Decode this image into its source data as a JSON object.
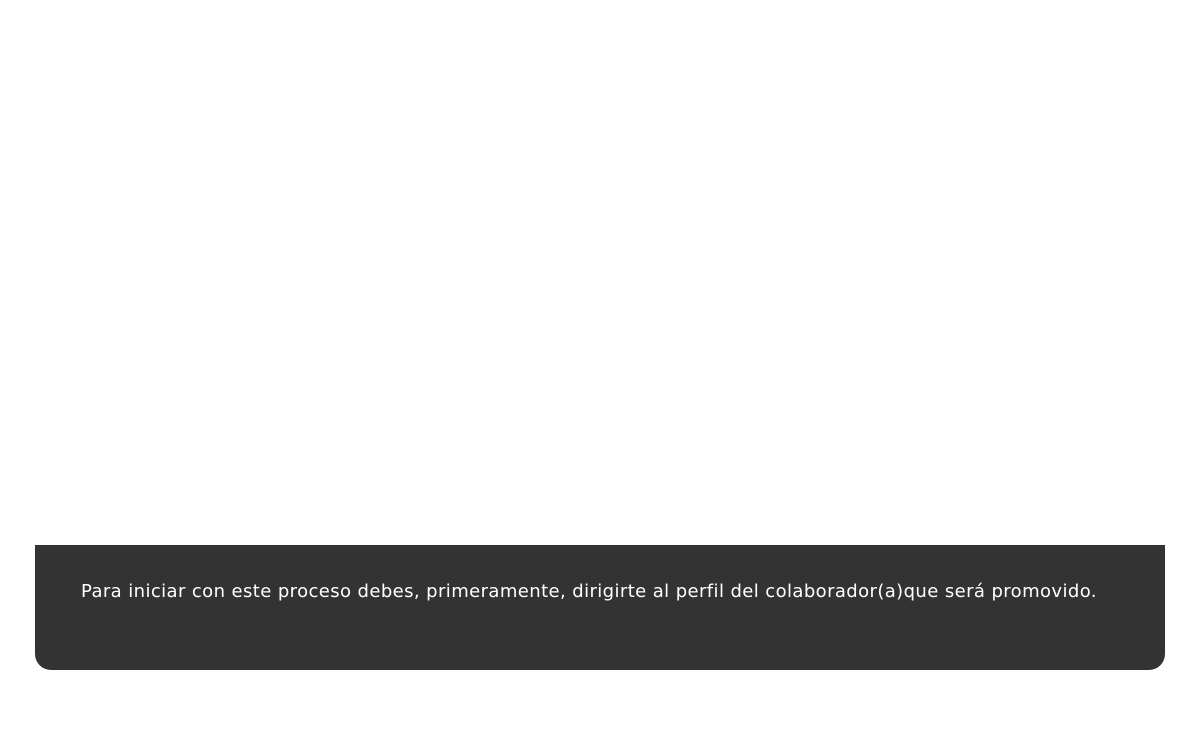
{
  "caption": {
    "text": "Para iniciar con este proceso debes, primeramente, dirigirte al perfil del colaborador(a)que será promovido."
  },
  "colors": {
    "background": "#ffffff",
    "caption_panel": "#333333",
    "caption_text": "#ffffff"
  }
}
